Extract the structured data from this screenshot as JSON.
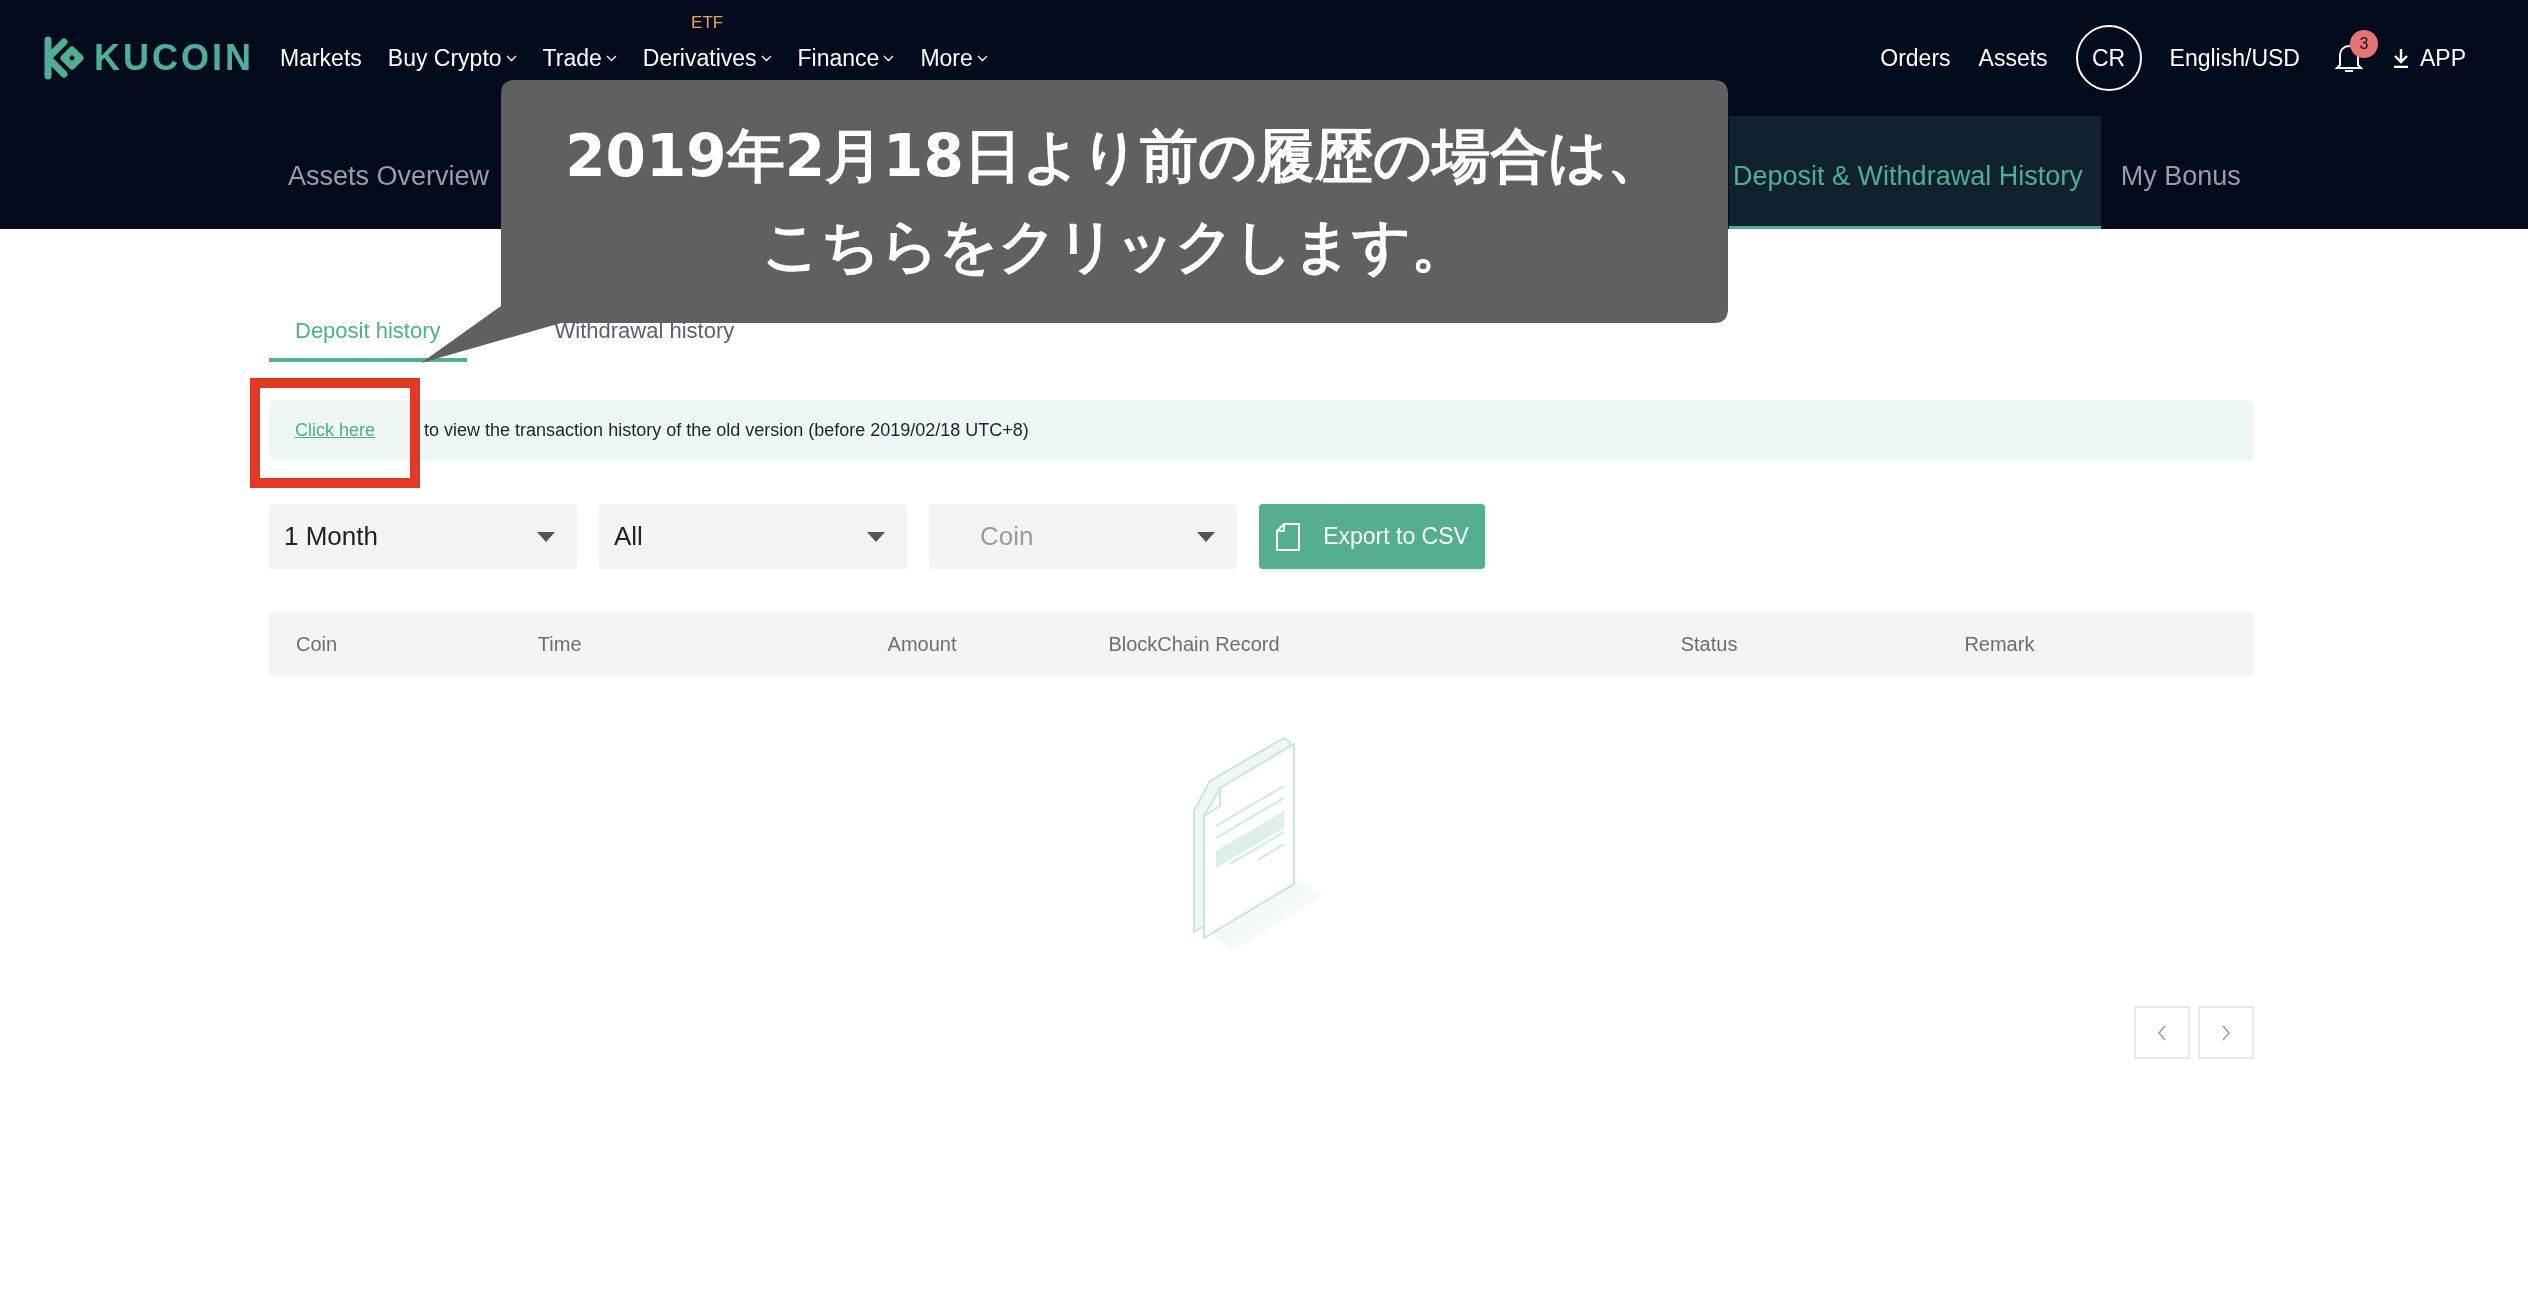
{
  "header": {
    "logo": "KUCOIN",
    "nav": [
      {
        "label": "Markets",
        "dropdown": false
      },
      {
        "label": "Buy Crypto",
        "dropdown": true
      },
      {
        "label": "Trade",
        "dropdown": true
      },
      {
        "label": "Derivatives",
        "dropdown": true,
        "badge": "ETF"
      },
      {
        "label": "Finance",
        "dropdown": true
      },
      {
        "label": "More",
        "dropdown": true
      }
    ],
    "orders": "Orders",
    "assets": "Assets",
    "avatar": "CR",
    "language": "English/USD",
    "notifications": "3",
    "app": "APP"
  },
  "subnav": [
    {
      "label": "Assets Overview",
      "selected": false
    },
    {
      "label": "Deposit & Withdrawal History",
      "selected": true
    },
    {
      "label": "My Bonus",
      "selected": false
    }
  ],
  "tabs": [
    {
      "label": "Deposit history",
      "selected": true
    },
    {
      "label": "Withdrawal history",
      "selected": false
    }
  ],
  "notice": {
    "link": "Click here",
    "text": " to view the transaction history of the old version (before 2019/02/18 UTC+8)"
  },
  "filters": [
    {
      "value": "1 Month"
    },
    {
      "value": "All"
    },
    {
      "placeholder": "Coin"
    }
  ],
  "export_button": "Export to CSV",
  "table": {
    "columns": [
      "Coin",
      "Time",
      "Amount",
      "BlockChain Record",
      "Status",
      "Remark"
    ]
  },
  "callout": {
    "lines": [
      "2019年2月18日より前の履歴の場合は、",
      "こちらをクリックします。"
    ]
  }
}
